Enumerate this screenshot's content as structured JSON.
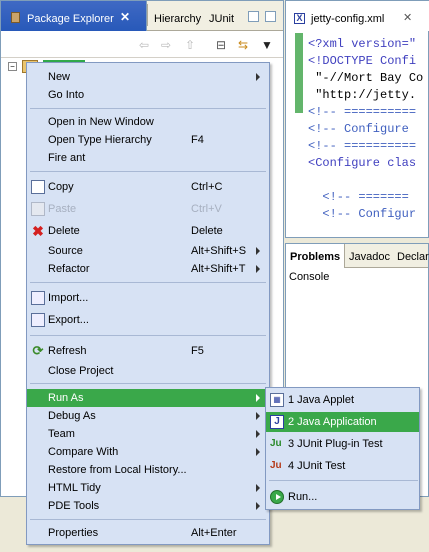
{
  "package_explorer": {
    "tab_active": "Package Explorer",
    "tab_hierarchy": "Hierarchy",
    "tab_junit": "JUnit",
    "close_glyph": "✕"
  },
  "editor": {
    "tab_title": "jetty-config.xml",
    "xml_icon": "X",
    "code_lines": [
      "<?xml version=\"",
      "<!DOCTYPE Confi",
      " \"-//Mort Bay Co",
      " \"http://jetty.",
      "<!-- ==========",
      "<!-- Configure ",
      "<!-- ==========",
      "<Configure clas",
      "",
      "  <!-- =======",
      "  <!-- Configur"
    ]
  },
  "problems_panel": {
    "tab_problems": "Problems",
    "tab_javadoc": "Javadoc",
    "tab_declaration": "Declara",
    "console_label": "Console"
  },
  "context_menu": {
    "items": {
      "new": "New",
      "go_into": "Go Into",
      "open_new_window": "Open in New Window",
      "open_type_hierarchy": "Open Type Hierarchy",
      "open_type_hierarchy_acc": "F4",
      "fire_ant": "Fire ant",
      "copy": "Copy",
      "copy_acc": "Ctrl+C",
      "paste": "Paste",
      "paste_acc": "Ctrl+V",
      "delete": "Delete",
      "delete_acc": "Delete",
      "source": "Source",
      "source_acc": "Alt+Shift+S",
      "refactor": "Refactor",
      "refactor_acc": "Alt+Shift+T",
      "import": "Import...",
      "export": "Export...",
      "refresh": "Refresh",
      "refresh_acc": "F5",
      "close_project": "Close Project",
      "run_as": "Run As",
      "debug_as": "Debug As",
      "team": "Team",
      "compare_with": "Compare With",
      "restore_local_history": "Restore from Local History...",
      "html_tidy": "HTML Tidy",
      "pde_tools": "PDE Tools",
      "properties": "Properties",
      "properties_acc": "Alt+Enter"
    }
  },
  "run_as_submenu": {
    "java_applet": "1 Java Applet",
    "java_application": "2 Java Application",
    "junit_plugin_test": "3 JUnit Plug-in Test",
    "junit_test": "4 JUnit Test",
    "run": "Run...",
    "junit_icon_text": "Ju"
  },
  "colors": {
    "highlight": "#3aa84a",
    "menu_bg": "#d7e2f4",
    "tab_active_bg": "#2859b9"
  }
}
